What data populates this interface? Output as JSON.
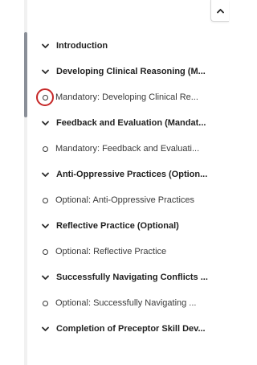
{
  "colors": {
    "highlight_ring": "#c62828",
    "text_section": "#1f1f1f",
    "text_item": "#3a3a3a",
    "scrollbar_thumb": "#8a8f98"
  },
  "icons": {
    "collapse": "chevron-up-icon",
    "section": "chevron-down-icon",
    "item": "empty-circle-icon"
  },
  "nav": [
    {
      "kind": "section",
      "label": "Introduction"
    },
    {
      "kind": "section",
      "label": "Developing Clinical Reasoning (M..."
    },
    {
      "kind": "item",
      "label": "Mandatory: Developing Clinical Re...",
      "highlighted": true
    },
    {
      "kind": "section",
      "label": "Feedback and Evaluation (Mandat..."
    },
    {
      "kind": "item",
      "label": "Mandatory: Feedback and Evaluati..."
    },
    {
      "kind": "section",
      "label": "Anti-Oppressive Practices (Option..."
    },
    {
      "kind": "item",
      "label": "Optional: Anti-Oppressive Practices"
    },
    {
      "kind": "section",
      "label": "Reflective Practice (Optional)"
    },
    {
      "kind": "item",
      "label": "Optional: Reflective Practice"
    },
    {
      "kind": "section",
      "label": "Successfully Navigating Conflicts ..."
    },
    {
      "kind": "item",
      "label": "Optional: Successfully Navigating ..."
    },
    {
      "kind": "section",
      "label": "Completion of Preceptor Skill Dev..."
    }
  ]
}
